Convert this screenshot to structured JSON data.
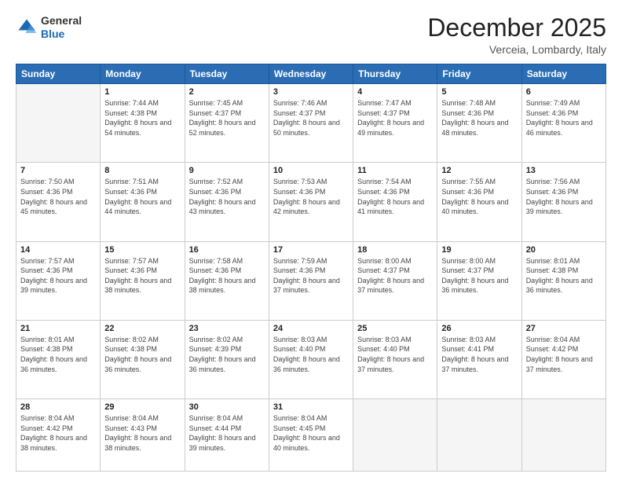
{
  "logo": {
    "general": "General",
    "blue": "Blue"
  },
  "header": {
    "month": "December 2025",
    "location": "Verceia, Lombardy, Italy"
  },
  "weekdays": [
    "Sunday",
    "Monday",
    "Tuesday",
    "Wednesday",
    "Thursday",
    "Friday",
    "Saturday"
  ],
  "weeks": [
    [
      {
        "day": "",
        "empty": true
      },
      {
        "day": "1",
        "sunrise": "7:44 AM",
        "sunset": "4:38 PM",
        "daylight": "8 hours and 54 minutes."
      },
      {
        "day": "2",
        "sunrise": "7:45 AM",
        "sunset": "4:37 PM",
        "daylight": "8 hours and 52 minutes."
      },
      {
        "day": "3",
        "sunrise": "7:46 AM",
        "sunset": "4:37 PM",
        "daylight": "8 hours and 50 minutes."
      },
      {
        "day": "4",
        "sunrise": "7:47 AM",
        "sunset": "4:37 PM",
        "daylight": "8 hours and 49 minutes."
      },
      {
        "day": "5",
        "sunrise": "7:48 AM",
        "sunset": "4:36 PM",
        "daylight": "8 hours and 48 minutes."
      },
      {
        "day": "6",
        "sunrise": "7:49 AM",
        "sunset": "4:36 PM",
        "daylight": "8 hours and 46 minutes."
      }
    ],
    [
      {
        "day": "7",
        "sunrise": "7:50 AM",
        "sunset": "4:36 PM",
        "daylight": "8 hours and 45 minutes."
      },
      {
        "day": "8",
        "sunrise": "7:51 AM",
        "sunset": "4:36 PM",
        "daylight": "8 hours and 44 minutes."
      },
      {
        "day": "9",
        "sunrise": "7:52 AM",
        "sunset": "4:36 PM",
        "daylight": "8 hours and 43 minutes."
      },
      {
        "day": "10",
        "sunrise": "7:53 AM",
        "sunset": "4:36 PM",
        "daylight": "8 hours and 42 minutes."
      },
      {
        "day": "11",
        "sunrise": "7:54 AM",
        "sunset": "4:36 PM",
        "daylight": "8 hours and 41 minutes."
      },
      {
        "day": "12",
        "sunrise": "7:55 AM",
        "sunset": "4:36 PM",
        "daylight": "8 hours and 40 minutes."
      },
      {
        "day": "13",
        "sunrise": "7:56 AM",
        "sunset": "4:36 PM",
        "daylight": "8 hours and 39 minutes."
      }
    ],
    [
      {
        "day": "14",
        "sunrise": "7:57 AM",
        "sunset": "4:36 PM",
        "daylight": "8 hours and 39 minutes."
      },
      {
        "day": "15",
        "sunrise": "7:57 AM",
        "sunset": "4:36 PM",
        "daylight": "8 hours and 38 minutes."
      },
      {
        "day": "16",
        "sunrise": "7:58 AM",
        "sunset": "4:36 PM",
        "daylight": "8 hours and 38 minutes."
      },
      {
        "day": "17",
        "sunrise": "7:59 AM",
        "sunset": "4:36 PM",
        "daylight": "8 hours and 37 minutes."
      },
      {
        "day": "18",
        "sunrise": "8:00 AM",
        "sunset": "4:37 PM",
        "daylight": "8 hours and 37 minutes."
      },
      {
        "day": "19",
        "sunrise": "8:00 AM",
        "sunset": "4:37 PM",
        "daylight": "8 hours and 36 minutes."
      },
      {
        "day": "20",
        "sunrise": "8:01 AM",
        "sunset": "4:38 PM",
        "daylight": "8 hours and 36 minutes."
      }
    ],
    [
      {
        "day": "21",
        "sunrise": "8:01 AM",
        "sunset": "4:38 PM",
        "daylight": "8 hours and 36 minutes."
      },
      {
        "day": "22",
        "sunrise": "8:02 AM",
        "sunset": "4:38 PM",
        "daylight": "8 hours and 36 minutes."
      },
      {
        "day": "23",
        "sunrise": "8:02 AM",
        "sunset": "4:39 PM",
        "daylight": "8 hours and 36 minutes."
      },
      {
        "day": "24",
        "sunrise": "8:03 AM",
        "sunset": "4:40 PM",
        "daylight": "8 hours and 36 minutes."
      },
      {
        "day": "25",
        "sunrise": "8:03 AM",
        "sunset": "4:40 PM",
        "daylight": "8 hours and 37 minutes."
      },
      {
        "day": "26",
        "sunrise": "8:03 AM",
        "sunset": "4:41 PM",
        "daylight": "8 hours and 37 minutes."
      },
      {
        "day": "27",
        "sunrise": "8:04 AM",
        "sunset": "4:42 PM",
        "daylight": "8 hours and 37 minutes."
      }
    ],
    [
      {
        "day": "28",
        "sunrise": "8:04 AM",
        "sunset": "4:42 PM",
        "daylight": "8 hours and 38 minutes."
      },
      {
        "day": "29",
        "sunrise": "8:04 AM",
        "sunset": "4:43 PM",
        "daylight": "8 hours and 38 minutes."
      },
      {
        "day": "30",
        "sunrise": "8:04 AM",
        "sunset": "4:44 PM",
        "daylight": "8 hours and 39 minutes."
      },
      {
        "day": "31",
        "sunrise": "8:04 AM",
        "sunset": "4:45 PM",
        "daylight": "8 hours and 40 minutes."
      },
      {
        "day": "",
        "empty": true
      },
      {
        "day": "",
        "empty": true
      },
      {
        "day": "",
        "empty": true
      }
    ]
  ]
}
